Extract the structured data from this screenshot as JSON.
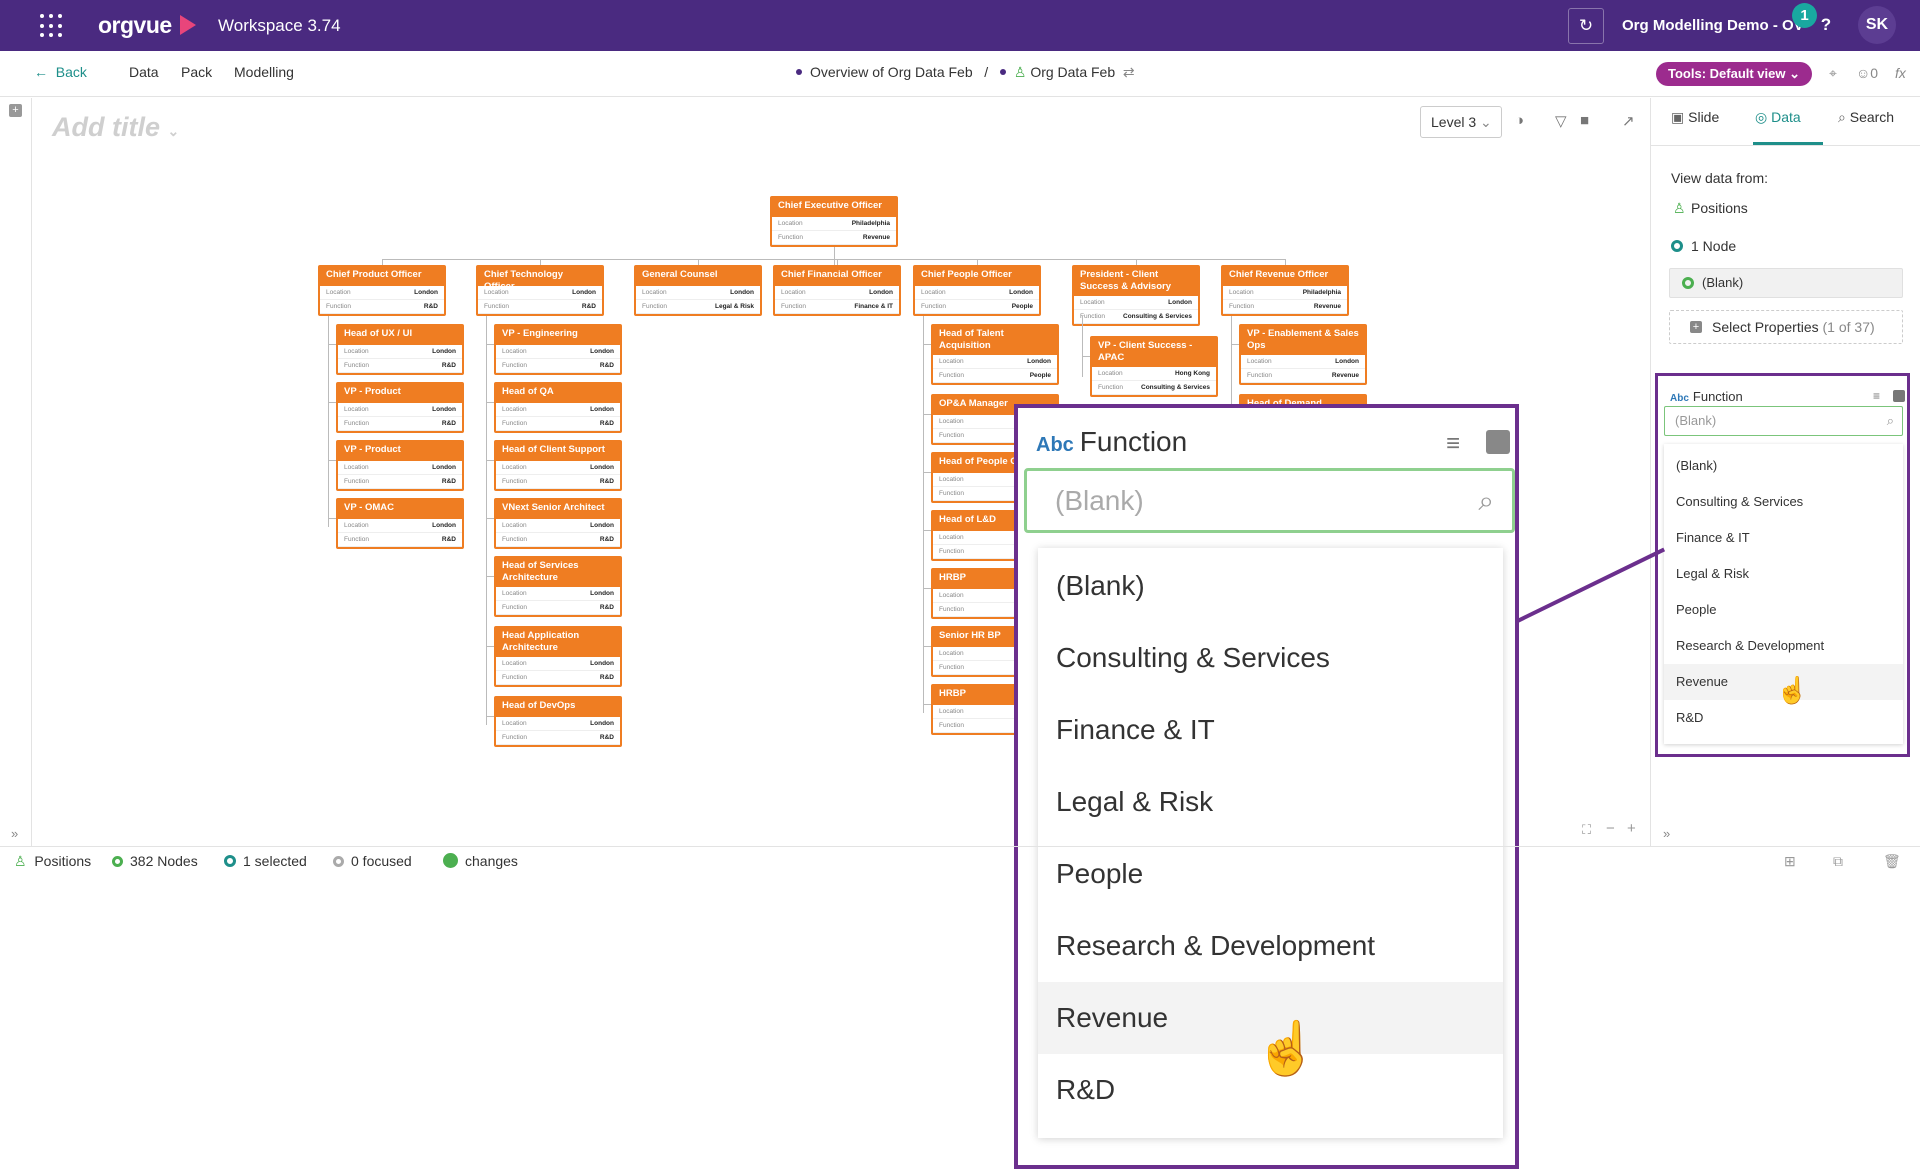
{
  "topbar": {
    "logo": "orgvue",
    "workspace": "Workspace  3.74",
    "project": "Org Modelling Demo - OV",
    "notif_count": "1",
    "help": "?",
    "avatar": "SK"
  },
  "navbar": {
    "back": "Back",
    "menu": [
      "Data",
      "Pack",
      "Modelling"
    ],
    "breadcrumb_1": "Overview of Org Data Feb",
    "breadcrumb_sep": "/",
    "breadcrumb_2": "Org Data Feb",
    "tools": "Tools: Default view",
    "user_count": "0",
    "fx": "fx"
  },
  "canvas": {
    "title_placeholder": "Add title",
    "level": "Level 3"
  },
  "org_chart": {
    "location_label": "Location",
    "function_label": "Function",
    "root": {
      "title": "Chief Executive Officer",
      "location": "Philadelphia",
      "function": "Revenue"
    },
    "columns": [
      {
        "head": {
          "title": "Chief Product Officer",
          "location": "London",
          "function": "R&D"
        },
        "children": [
          {
            "title": "Head of UX / UI",
            "location": "London",
            "function": "R&D"
          },
          {
            "title": "VP - Product",
            "location": "London",
            "function": "R&D"
          },
          {
            "title": "VP - Product",
            "location": "London",
            "function": "R&D"
          },
          {
            "title": "VP - OMAC",
            "location": "London",
            "function": "R&D"
          }
        ]
      },
      {
        "head": {
          "title": "Chief Technology Officer",
          "location": "London",
          "function": "R&D"
        },
        "children": [
          {
            "title": "VP - Engineering",
            "location": "London",
            "function": "R&D"
          },
          {
            "title": "Head of QA",
            "location": "London",
            "function": "R&D"
          },
          {
            "title": "Head of Client Support",
            "location": "London",
            "function": "R&D"
          },
          {
            "title": "VNext Senior Architect",
            "location": "London",
            "function": "R&D"
          },
          {
            "title": "Head of Services Architecture",
            "location": "London",
            "function": "R&D"
          },
          {
            "title": "Head Application Architecture",
            "location": "London",
            "function": "R&D"
          },
          {
            "title": "Head of DevOps",
            "location": "London",
            "function": "R&D"
          }
        ]
      },
      {
        "head": {
          "title": "General Counsel",
          "location": "London",
          "function": "Legal & Risk"
        },
        "children": []
      },
      {
        "head": {
          "title": "Chief Financial Officer",
          "location": "London",
          "function": "Finance & IT"
        },
        "children": []
      },
      {
        "head": {
          "title": "Chief People Officer",
          "location": "London",
          "function": "People"
        },
        "children": [
          {
            "title": "Head of Talent Acquisition",
            "location": "London",
            "function": "People"
          },
          {
            "title": "OP&A Manager",
            "location": "",
            "function": ""
          },
          {
            "title": "Head of People O",
            "location": "",
            "function": ""
          },
          {
            "title": "Head of L&D",
            "location": "",
            "function": ""
          },
          {
            "title": "HRBP",
            "location": "",
            "function": ""
          },
          {
            "title": "Senior HR BP",
            "location": "",
            "function": ""
          },
          {
            "title": "HRBP",
            "location": "",
            "function": ""
          }
        ]
      },
      {
        "head": {
          "title": "President - Client Success & Advisory",
          "location": "London",
          "function": "Consulting & Services"
        },
        "children": [
          {
            "title": "VP - Client Success - APAC",
            "location": "Hong Kong",
            "function": "Consulting & Services"
          }
        ]
      },
      {
        "head": {
          "title": "Chief Revenue Officer",
          "location": "Philadelphia",
          "function": "Revenue"
        },
        "children": [
          {
            "title": "VP - Enablement & Sales Ops",
            "location": "London",
            "function": "Revenue"
          },
          {
            "title": "Head of Demand",
            "location": "",
            "function": ""
          }
        ]
      }
    ]
  },
  "right_panel": {
    "tabs": [
      "Slide",
      "Data",
      "Search"
    ],
    "view_data_from": "View data from:",
    "positions": "Positions",
    "node_count": "1 Node",
    "blank": "(Blank)",
    "select_props": "Select Properties",
    "select_props_count": "(1 of 37)"
  },
  "function_filter": {
    "abc": "Abc",
    "title": "Function",
    "input_value": "(Blank)",
    "options": [
      "(Blank)",
      "Consulting & Services",
      "Finance & IT",
      "Legal & Risk",
      "People",
      "Research & Development",
      "Revenue",
      "R&D"
    ],
    "hovered": "Revenue"
  },
  "status_bar": {
    "positions": "Positions",
    "nodes": "382 Nodes",
    "selected": "1 selected",
    "focused": "0 focused",
    "changes": "changes"
  },
  "colors": {
    "topbar": "#4a2a80",
    "accent": "#1e8f8a",
    "card": "#ef7d22",
    "highlight": "#6b2f8d",
    "tools": "#9c2b8e"
  }
}
